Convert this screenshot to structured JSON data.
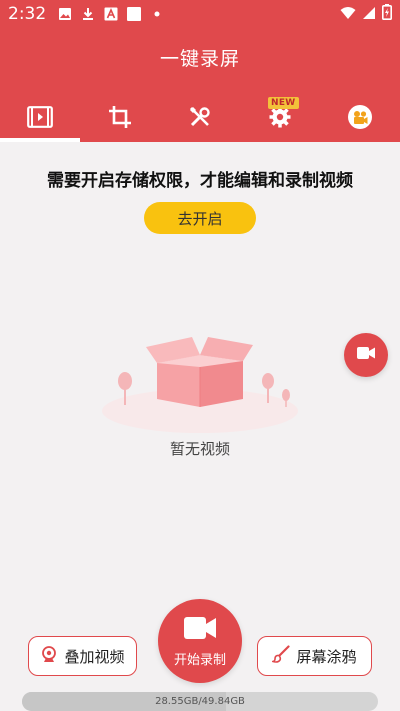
{
  "status_bar": {
    "time": "2:32",
    "left_icons": [
      "image-icon",
      "download-icon",
      "a-icon",
      "square-icon",
      "dot-icon"
    ],
    "right_icons": [
      "wifi-icon",
      "signal-icon",
      "battery-charging-icon"
    ]
  },
  "header": {
    "title": "一键录屏",
    "tabs": [
      {
        "icon": "video-list-icon",
        "active": true
      },
      {
        "icon": "crop-icon"
      },
      {
        "icon": "tools-icon"
      },
      {
        "icon": "settings-icon",
        "badge": "NEW"
      },
      {
        "icon": "camera-reel-icon"
      }
    ]
  },
  "permission": {
    "message": "需要开启存储权限，才能编辑和录制视频",
    "button_label": "去开启"
  },
  "empty_state": {
    "text": "暂无视频",
    "illustration": "empty-box-illustration"
  },
  "bottom": {
    "overlay_label": "叠加视频",
    "record_label": "开始录制",
    "doodle_label": "屏幕涂鸦"
  },
  "storage": {
    "text": "28.55GB/49.84GB",
    "used_fraction": 0.573
  },
  "colors": {
    "primary": "#e0494c",
    "accent": "#f9c20f",
    "background": "#f3f1f2"
  }
}
